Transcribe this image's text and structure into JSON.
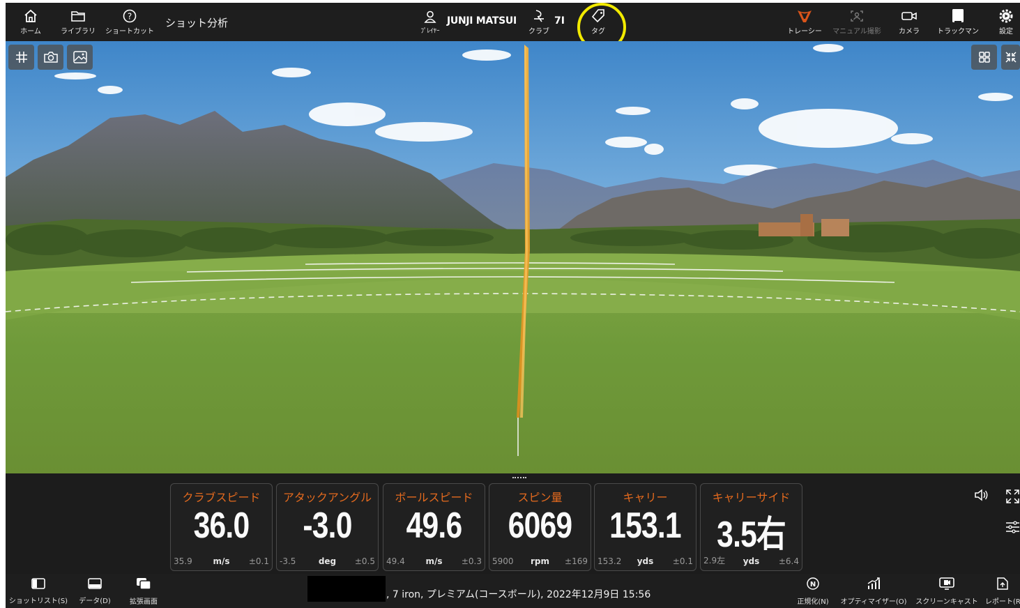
{
  "topbar": {
    "home": {
      "label": "ホーム",
      "icon": "home-icon"
    },
    "library": {
      "label": "ライブラリ",
      "icon": "folder-icon"
    },
    "shortcut": {
      "label": "ショートカット",
      "icon": "help-icon"
    },
    "title": "ショット分析",
    "player": {
      "name": "JUNJI MATSUI",
      "label": "ﾌﾟﾚｲﾔｰ",
      "icon": "user-icon"
    },
    "club": {
      "value": "7I",
      "label": "クラブ",
      "icon": "club-icon"
    },
    "tag": {
      "label": "タグ",
      "icon": "tag-icon"
    },
    "tracer": {
      "label": "トレーシー",
      "icon": "tracer-icon"
    },
    "manual": {
      "label": "マニュアル撮影",
      "icon": "manual-capture-icon"
    },
    "camera": {
      "label": "カメラ",
      "icon": "camera-icon"
    },
    "trackman": {
      "label": "トラックマン",
      "icon": "trackman-icon"
    },
    "settings": {
      "label": "設定",
      "icon": "settings-icon"
    },
    "highlight_color": "#f2ea00"
  },
  "view_controls": [
    "grid-icon",
    "snapshot-icon",
    "image-icon",
    "layout-icon",
    "collapse-icon"
  ],
  "trajectory_color": "#f0a22a",
  "metrics": [
    {
      "title": "クラブスピード",
      "value": "36.0",
      "low": "35.9",
      "unit": "m/s",
      "range": "±0.1"
    },
    {
      "title": "アタックアングル",
      "value": "-3.0",
      "low": "-3.5",
      "unit": "deg",
      "range": "±0.5"
    },
    {
      "title": "ボールスピード",
      "value": "49.6",
      "low": "49.4",
      "unit": "m/s",
      "range": "±0.3"
    },
    {
      "title": "スピン量",
      "value": "6069",
      "low": "5900",
      "unit": "rpm",
      "range": "±169"
    },
    {
      "title": "キャリー",
      "value": "153.1",
      "low": "153.2",
      "unit": "yds",
      "range": "±0.1"
    },
    {
      "title": "キャリーサイド",
      "value": "3.5右",
      "low": "2.9左",
      "unit": "yds",
      "range": "±6.4"
    }
  ],
  "metric_title_color": "#e46a1e",
  "bottombar": {
    "shot_list": "ショットリスト(S)",
    "data": "データ(D)",
    "expand": "拡張画面",
    "shot_info": ", 7 iron, プレミアム(コースボール), 2022年12月9日 15:56",
    "normalize": "正規化(N)",
    "optimizer": "オプティマイザー(O)",
    "screencast": "スクリーンキャスト",
    "report": "レポート(R)"
  }
}
